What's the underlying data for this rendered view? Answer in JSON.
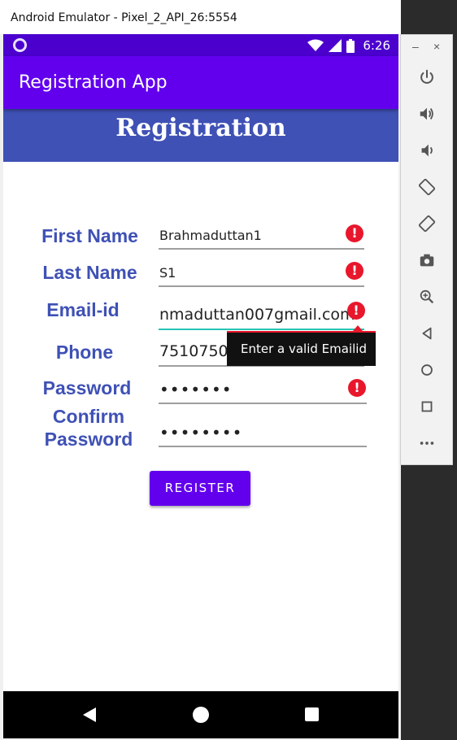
{
  "window": {
    "title": "Android Emulator - Pixel_2_API_26:5554"
  },
  "status_bar": {
    "time": "6:26"
  },
  "app_bar": {
    "title": "Registration App"
  },
  "header": {
    "title": "Registration"
  },
  "form": {
    "first_name": {
      "label": "First Name",
      "value": "Brahmaduttan1",
      "error": true
    },
    "last_name": {
      "label": "Last Name",
      "value": "S1",
      "error": true
    },
    "email": {
      "label": "Email-id",
      "value": "nmaduttan007gmail.com",
      "error": true
    },
    "phone": {
      "label": "Phone",
      "value": "751075049"
    },
    "password": {
      "label": "Password",
      "value": "•••••••",
      "error": true
    },
    "confirm_password": {
      "label_line1": "Confirm",
      "label_line2": "Password",
      "value": "••••••••"
    },
    "error_tooltip": "Enter a valid Emailid",
    "register_label": "REGISTER"
  },
  "side_toolbar": {
    "minimize": "–",
    "close": "×",
    "tools": [
      "power-icon",
      "volume-up-icon",
      "volume-down-icon",
      "rotate-left-icon",
      "rotate-right-icon",
      "camera-icon",
      "zoom-icon",
      "back-icon",
      "home-icon",
      "overview-icon",
      "more-icon"
    ]
  },
  "colors": {
    "primary": "#6200ee",
    "status_bar": "#4b00ce",
    "header": "#3f51b5",
    "label": "#3f51b5",
    "error": "#e8172c",
    "focus_underline": "#26c6b4"
  }
}
